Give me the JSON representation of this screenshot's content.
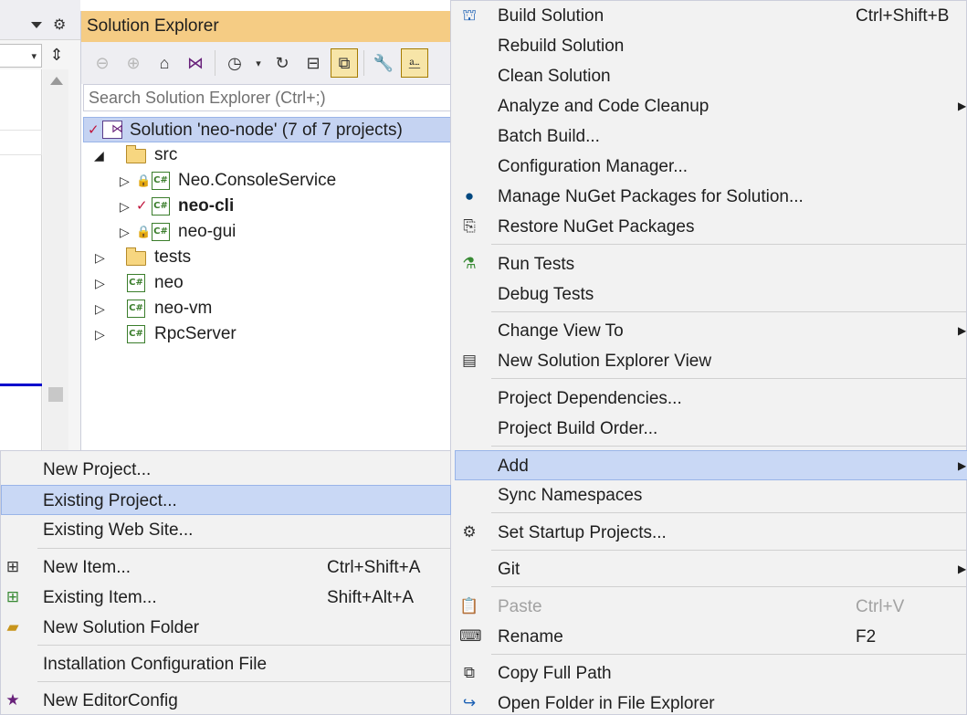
{
  "left_panel": {
    "split_glyph": "⇕"
  },
  "solution_explorer": {
    "title": "Solution Explorer",
    "search_placeholder": "Search Solution Explorer (Ctrl+;)",
    "toolbar_icons": [
      "back-icon",
      "forward-icon",
      "home-icon",
      "switch-views-icon",
      "pending-changes-icon",
      "sync-icon",
      "collapse-all-icon",
      "show-all-files-icon",
      "properties-icon",
      "preview-icon"
    ],
    "tree": {
      "solution": "Solution 'neo-node' (7 of 7 projects)",
      "src": "src",
      "items": [
        {
          "label": "Neo.ConsoleService"
        },
        {
          "label": "neo-cli"
        },
        {
          "label": "neo-gui"
        }
      ],
      "tests": "tests",
      "neo": "neo",
      "neovm": "neo-vm",
      "rpc": "RpcServer",
      "cs_glyph": "C#"
    }
  },
  "main_menu": {
    "build_solution": "Build Solution",
    "build_solution_shortcut": "Ctrl+Shift+B",
    "rebuild_solution": "Rebuild Solution",
    "clean_solution": "Clean Solution",
    "analyze": "Analyze and Code Cleanup",
    "batch_build": "Batch Build...",
    "config_manager": "Configuration Manager...",
    "manage_nuget": "Manage NuGet Packages for Solution...",
    "restore_nuget": "Restore NuGet Packages",
    "run_tests": "Run Tests",
    "debug_tests": "Debug Tests",
    "change_view": "Change View To",
    "new_se_view": "New Solution Explorer View",
    "project_deps": "Project Dependencies...",
    "project_build_order": "Project Build Order...",
    "add": "Add",
    "sync_namespaces": "Sync Namespaces",
    "set_startup": "Set Startup Projects...",
    "git": "Git",
    "paste": "Paste",
    "paste_shortcut": "Ctrl+V",
    "rename": "Rename",
    "rename_shortcut": "F2",
    "copy_full_path": "Copy Full Path",
    "open_folder": "Open Folder in File Explorer"
  },
  "add_submenu": {
    "new_project": "New Project...",
    "existing_project": "Existing Project...",
    "existing_web_site": "Existing Web Site...",
    "new_item": "New Item...",
    "new_item_shortcut": "Ctrl+Shift+A",
    "existing_item": "Existing Item...",
    "existing_item_shortcut": "Shift+Alt+A",
    "new_solution_folder": "New Solution Folder",
    "installation_config": "Installation Configuration File",
    "new_editorconfig": "New EditorConfig"
  },
  "colors": {
    "title_bar": "#f5cc84",
    "highlight": "#c9d8f5",
    "menu_bg": "#f2f2f2"
  }
}
